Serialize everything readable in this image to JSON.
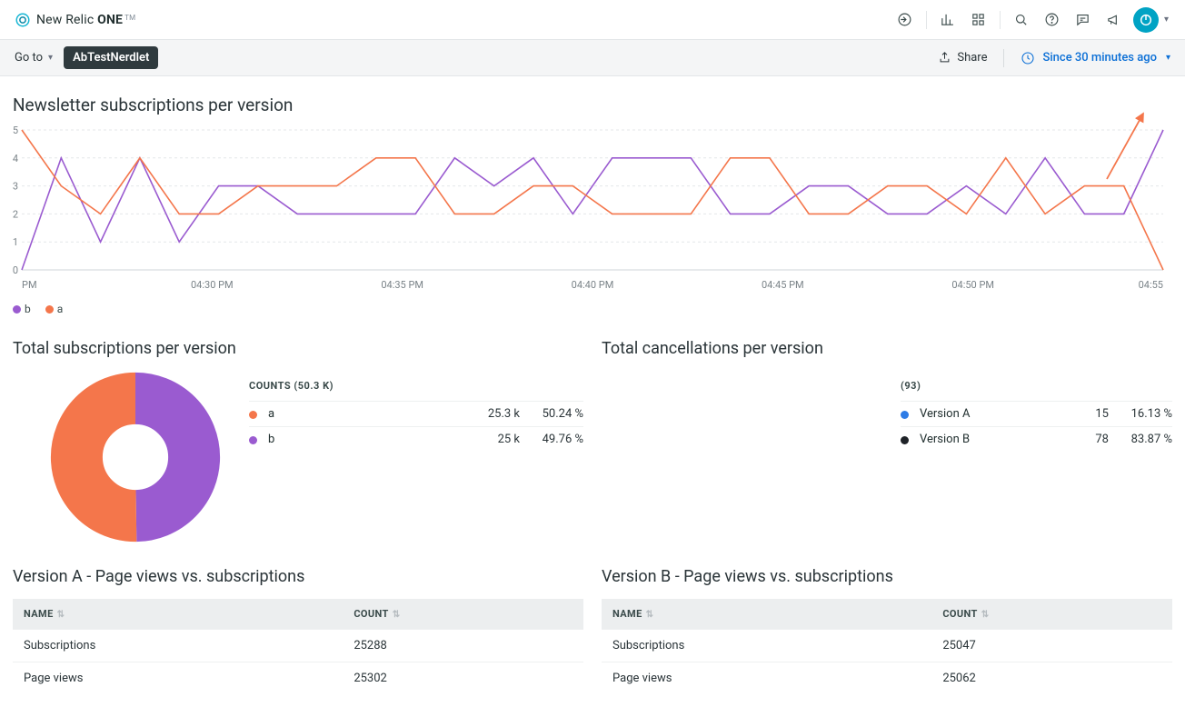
{
  "brand": {
    "prefix": "New Relic",
    "bold": "ONE"
  },
  "subbar": {
    "goto_label": "Go to",
    "nerdlet_pill": "AbTestNerdlet",
    "share_label": "Share",
    "timerange_label": "Since 30 minutes ago"
  },
  "chart1": {
    "title": "Newsletter subscriptions per version"
  },
  "chart2_left": {
    "title": "Total subscriptions per version",
    "counts_label": "COUNTS (50.3 K)",
    "rows": [
      {
        "label": "a",
        "value": "25.3 k",
        "pct": "50.24 %"
      },
      {
        "label": "b",
        "value": "25 k",
        "pct": "49.76 %"
      }
    ]
  },
  "chart2_right": {
    "title": "Total cancellations per version",
    "counts_label": "(93)",
    "rows": [
      {
        "label": "Version A",
        "value": "15",
        "pct": "16.13 %"
      },
      {
        "label": "Version B",
        "value": "78",
        "pct": "83.87 %"
      }
    ]
  },
  "tables": {
    "left_title": "Version A - Page views vs. subscriptions",
    "right_title": "Version B - Page views vs. subscriptions",
    "col_name": "NAME",
    "col_count": "COUNT",
    "left_rows": [
      {
        "name": "Subscriptions",
        "count": "25288"
      },
      {
        "name": "Page views",
        "count": "25302"
      }
    ],
    "right_rows": [
      {
        "name": "Subscriptions",
        "count": "25047"
      },
      {
        "name": "Page views",
        "count": "25062"
      }
    ]
  },
  "legend": {
    "b": "b",
    "a": "a"
  },
  "colors": {
    "purple": "#9a5bd0",
    "orange": "#f4764b",
    "pie_blue": "#2e7ce6",
    "black": "#1f2328"
  },
  "chart_data": [
    {
      "type": "line",
      "title": "Newsletter subscriptions per version",
      "ylabel": "",
      "xlabel": "",
      "ylim": [
        0,
        5
      ],
      "x_ticks": [
        "PM",
        "04:30 PM",
        "04:35 PM",
        "04:40 PM",
        "04:45 PM",
        "04:50 PM",
        "04:55"
      ],
      "categories": [
        0,
        1,
        2,
        3,
        4,
        5,
        6,
        7,
        8,
        9,
        10,
        11,
        12,
        13,
        14,
        15,
        16,
        17,
        18,
        19,
        20,
        21,
        22,
        23,
        24,
        25,
        26,
        27,
        28,
        29
      ],
      "series": [
        {
          "name": "b",
          "color": "#9a5bd0",
          "values": [
            0,
            4,
            1,
            4,
            1,
            3,
            3,
            2,
            2,
            2,
            2,
            4,
            3,
            4,
            2,
            4,
            4,
            4,
            2,
            2,
            3,
            3,
            2,
            2,
            3,
            2,
            4,
            2,
            2,
            5
          ]
        },
        {
          "name": "a",
          "color": "#f4764b",
          "values": [
            5,
            3,
            2,
            4,
            2,
            2,
            3,
            3,
            3,
            4,
            4,
            2,
            2,
            3,
            3,
            2,
            2,
            2,
            4,
            4,
            2,
            2,
            3,
            3,
            2,
            4,
            2,
            3,
            3,
            0
          ]
        }
      ]
    },
    {
      "type": "pie",
      "title": "Total subscriptions per version",
      "series": [
        {
          "name": "a",
          "value": 25300,
          "pct": 50.24,
          "color": "#f4764b"
        },
        {
          "name": "b",
          "value": 25000,
          "pct": 49.76,
          "color": "#9a5bd0"
        }
      ],
      "total_label": "50.3 K"
    },
    {
      "type": "pie",
      "title": "Total cancellations per version",
      "series": [
        {
          "name": "Version A",
          "value": 15,
          "pct": 16.13,
          "color": "#2e7ce6"
        },
        {
          "name": "Version B",
          "value": 78,
          "pct": 83.87,
          "color": "#1f2328"
        }
      ],
      "total_label": "93"
    },
    {
      "type": "table",
      "title": "Version A - Page views vs. subscriptions",
      "columns": [
        "NAME",
        "COUNT"
      ],
      "rows": [
        [
          "Subscriptions",
          25288
        ],
        [
          "Page views",
          25302
        ]
      ]
    },
    {
      "type": "table",
      "title": "Version B - Page views vs. subscriptions",
      "columns": [
        "NAME",
        "COUNT"
      ],
      "rows": [
        [
          "Subscriptions",
          25047
        ],
        [
          "Page views",
          25062
        ]
      ]
    }
  ]
}
